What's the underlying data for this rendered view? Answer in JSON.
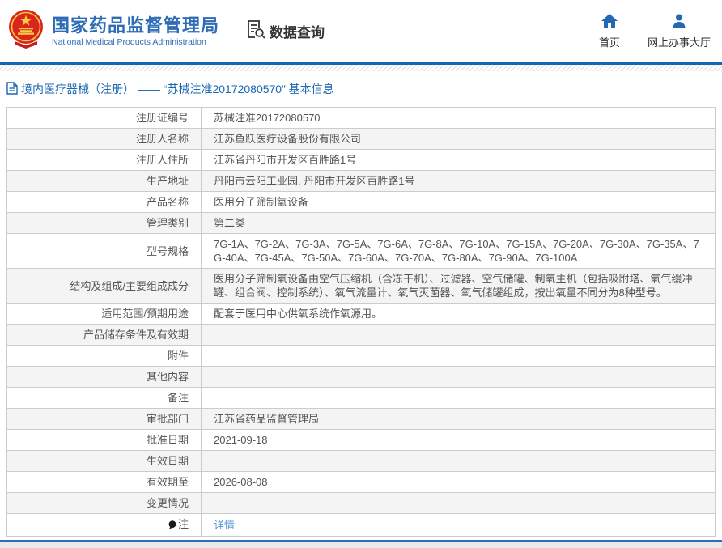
{
  "header": {
    "agency_name_zh": "国家药品监督管理局",
    "agency_name_en": "National Medical Products Administration",
    "section_title": "数据查询",
    "nav": [
      {
        "icon": "home-icon",
        "label": "首页"
      },
      {
        "icon": "person-icon",
        "label": "网上办事大厅"
      }
    ]
  },
  "breadcrumb": {
    "text": "境内医疗器械（注册） —— “苏械注准20172080570” 基本信息"
  },
  "table": {
    "rows": [
      {
        "label": "注册证编号",
        "value": "苏械注准20172080570"
      },
      {
        "label": "注册人名称",
        "value": "江苏鱼跃医疗设备股份有限公司"
      },
      {
        "label": "注册人住所",
        "value": "江苏省丹阳市开发区百胜路1号"
      },
      {
        "label": "生产地址",
        "value": "丹阳市云阳工业园, 丹阳市开发区百胜路1号"
      },
      {
        "label": "产品名称",
        "value": "医用分子筛制氧设备"
      },
      {
        "label": "管理类别",
        "value": "第二类"
      },
      {
        "label": "型号规格",
        "value": "7G-1A、7G-2A、7G-3A、7G-5A、7G-6A、7G-8A、7G-10A、7G-15A、7G-20A、7G-30A、7G-35A、7G-40A、7G-45A、7G-50A、7G-60A、7G-70A、7G-80A、7G-90A、7G-100A"
      },
      {
        "label": "结构及组成/主要组成成分",
        "value": "医用分子筛制氧设备由空气压缩机（含冻干机）、过滤器、空气储罐、制氧主机（包括吸附塔、氧气缓冲罐、组合阀、控制系统）、氧气流量计、氧气灭菌器、氧气储罐组成，按出氧量不同分为8种型号。"
      },
      {
        "label": "适用范围/预期用途",
        "value": "配套于医用中心供氧系统作氧源用。"
      },
      {
        "label": "产品储存条件及有效期",
        "value": ""
      },
      {
        "label": "附件",
        "value": ""
      },
      {
        "label": "其他内容",
        "value": ""
      },
      {
        "label": "备注",
        "value": ""
      },
      {
        "label": "审批部门",
        "value": "江苏省药品监督管理局"
      },
      {
        "label": "批准日期",
        "value": "2021-09-18"
      },
      {
        "label": "生效日期",
        "value": ""
      },
      {
        "label": "有效期至",
        "value": "2026-08-08"
      },
      {
        "label": "变更情况",
        "value": ""
      },
      {
        "label": "注",
        "value": "详情",
        "link": true,
        "label_icon": "note-balloon-icon"
      }
    ]
  },
  "colors": {
    "brand_blue": "#2e6db5",
    "header_rule_blue": "#1565b2",
    "breadcrumb_blue": "#1a66b3",
    "link_blue": "#5b9bd5",
    "table_border": "#cccccc",
    "alt_row_bg": "#f4f4f4",
    "text_gray": "#555555",
    "emblem_red": "#d8261c",
    "emblem_gold": "#f7c948"
  }
}
